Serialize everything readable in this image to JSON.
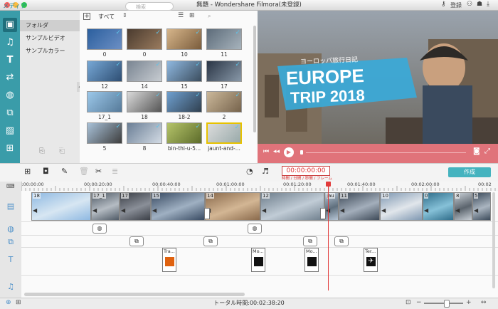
{
  "window": {
    "title": "無題 - Wondershare Filmora(未登録)",
    "register_label": "登録"
  },
  "sidebar": {
    "header": "メディア",
    "items": [
      {
        "label": "フォルダ",
        "active": true
      },
      {
        "label": "サンプルビデオ",
        "active": false
      },
      {
        "label": "サンプルカラー",
        "active": false
      }
    ]
  },
  "library": {
    "filter_label": "すべて",
    "search_placeholder": "検索",
    "items": [
      {
        "label": "0"
      },
      {
        "label": "0"
      },
      {
        "label": "10"
      },
      {
        "label": "11"
      },
      {
        "label": "12"
      },
      {
        "label": "14"
      },
      {
        "label": "15"
      },
      {
        "label": "17"
      },
      {
        "label": "17_1"
      },
      {
        "label": "18"
      },
      {
        "label": "18-2"
      },
      {
        "label": "2"
      },
      {
        "label": "5"
      },
      {
        "label": "8"
      },
      {
        "label": "bin-thi-u-5..."
      },
      {
        "label": "jaunt-and-..."
      }
    ]
  },
  "preview": {
    "subtitle": "ヨーロッパ旅行日記",
    "line1": "EUROPE",
    "line2": "TRIP 2018"
  },
  "timeline_toolbar": {
    "timecode": "00:00:00:00",
    "timecode_format": "時間 / 分間 / 秒間 / フレーム",
    "export_label": "作成"
  },
  "ruler": {
    "ticks": [
      "00:00:00:00",
      "00:00:20:00",
      "00:00:40:00",
      "00:01:00:00",
      "00:01:20:00",
      "00:01:40:00",
      "00:02:00:00",
      "00:02"
    ]
  },
  "timeline": {
    "clips": [
      {
        "label": "18"
      },
      {
        "label": "17_1"
      },
      {
        "label": "17"
      },
      {
        "label": "15"
      },
      {
        "label": "14"
      },
      {
        "label": "12"
      },
      {
        "label": "jau"
      },
      {
        "label": "11"
      },
      {
        "label": "10"
      },
      {
        "label": "0"
      },
      {
        "label": "8"
      },
      {
        "label": "5"
      }
    ],
    "title_clips": [
      {
        "label": "Tra..."
      },
      {
        "label": "Mo..."
      },
      {
        "label": "Mo..."
      },
      {
        "label": "Ter..."
      }
    ]
  },
  "status": {
    "total_time": "トータル時間:00:02:38:20"
  },
  "colors": {
    "accent": "#3a9ca9",
    "playhead": "#e23b3b",
    "preview_controls": "#e0737a"
  }
}
